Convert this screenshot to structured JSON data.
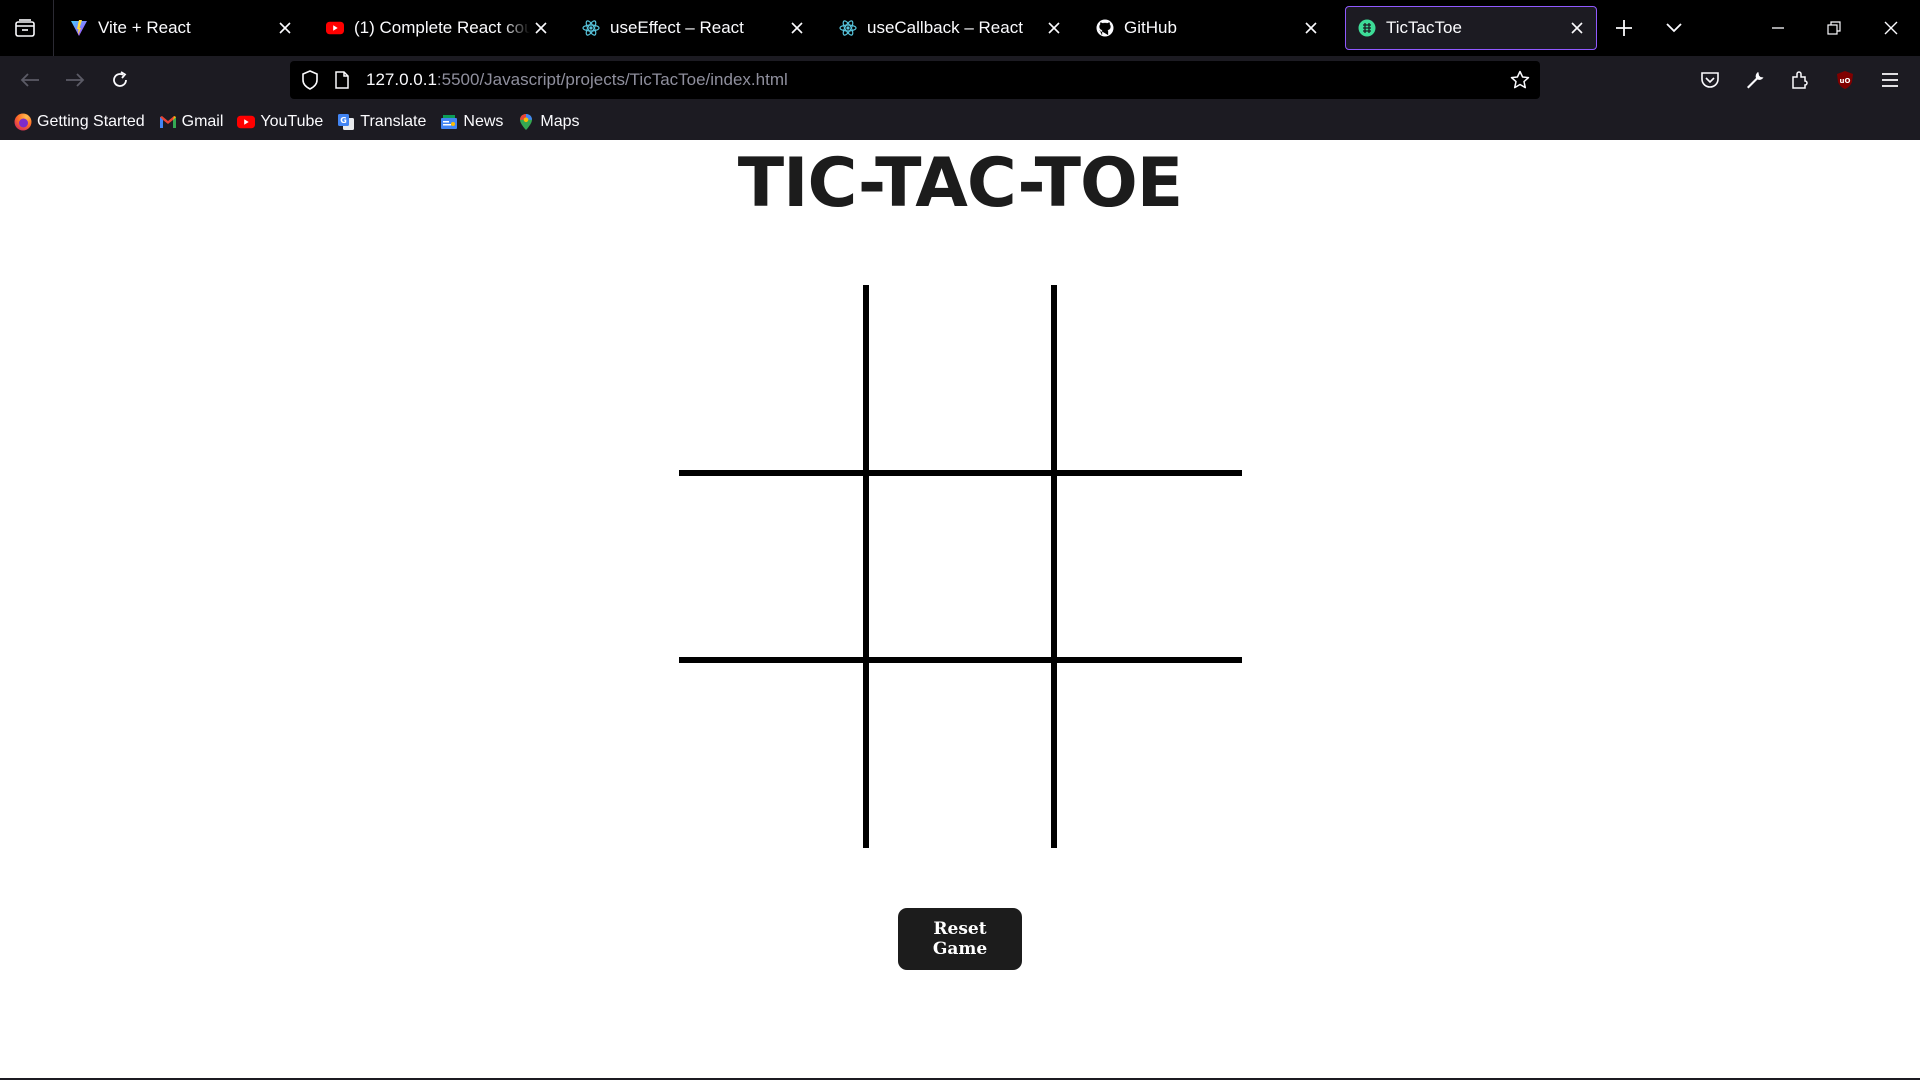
{
  "browser": {
    "tabs": [
      {
        "title": "Vite + React",
        "icon": "vite-icon",
        "active": false
      },
      {
        "title": "(1) Complete React course",
        "icon": "youtube-icon",
        "active": false
      },
      {
        "title": "useEffect – React",
        "icon": "react-icon",
        "active": false
      },
      {
        "title": "useCallback – React",
        "icon": "react-icon",
        "active": false
      },
      {
        "title": "GitHub",
        "icon": "github-icon",
        "active": false
      },
      {
        "title": "TicTacToe",
        "icon": "live-server-icon",
        "active": true
      }
    ],
    "url": {
      "host": "127.0.0.1",
      "path": ":5500/Javascript/projects/TicTacToe/index.html"
    },
    "bookmarks": [
      {
        "label": "Getting Started",
        "icon": "firefox-icon"
      },
      {
        "label": "Gmail",
        "icon": "gmail-icon"
      },
      {
        "label": "YouTube",
        "icon": "youtube-icon"
      },
      {
        "label": "Translate",
        "icon": "translate-icon"
      },
      {
        "label": "News",
        "icon": "news-icon"
      },
      {
        "label": "Maps",
        "icon": "maps-icon"
      }
    ],
    "colors": {
      "active_tab_border": "#9059ff",
      "chrome_bg": "#1c1b22",
      "tabstrip_bg": "#000000"
    }
  },
  "page": {
    "title": "TIC-TAC-TOE",
    "board": {
      "cells": [
        "",
        "",
        "",
        "",
        "",
        "",
        "",
        "",
        ""
      ]
    },
    "reset_label": "Reset Game"
  }
}
